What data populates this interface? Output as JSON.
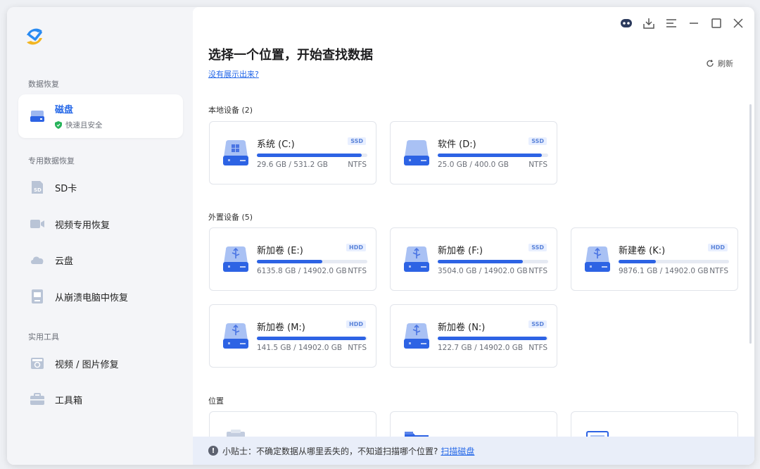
{
  "sidebar": {
    "section_data_recovery": "数据恢复",
    "disk": {
      "label": "磁盘",
      "sub": "快速且安全"
    },
    "section_special": "专用数据恢复",
    "items": [
      {
        "label": "SD卡"
      },
      {
        "label": "视频专用恢复"
      },
      {
        "label": "云盘"
      },
      {
        "label": "从崩溃电脑中恢复"
      }
    ],
    "section_tools": "实用工具",
    "tools": [
      {
        "label": "视频 / 图片修复"
      },
      {
        "label": "工具箱"
      }
    ]
  },
  "main": {
    "title": "选择一个位置，开始查找数据",
    "not_shown_link": "没有展示出来?",
    "refresh": "刷新",
    "local_label": "本地设备 (2)",
    "external_label": "外置设备 (5)",
    "location_label": "位置",
    "local_drives": [
      {
        "name": "系统 (C:)",
        "badge": "SSD",
        "size": "29.6 GB / 531.2 GB",
        "fs": "NTFS",
        "usage": 0.95
      },
      {
        "name": "软件 (D:)",
        "badge": "SSD",
        "size": "25.0 GB / 400.0 GB",
        "fs": "NTFS",
        "usage": 0.94
      }
    ],
    "external_drives": [
      {
        "name": "新加卷 (E:)",
        "badge": "HDD",
        "size": "6135.8 GB / 14902.0 GB",
        "fs": "NTFS",
        "usage": 0.59
      },
      {
        "name": "新加卷 (F:)",
        "badge": "SSD",
        "size": "3504.0 GB / 14902.0 GB",
        "fs": "NTFS",
        "usage": 0.77
      },
      {
        "name": "新建卷 (K:)",
        "badge": "HDD",
        "size": "9876.1 GB / 14902.0 GB",
        "fs": "NTFS",
        "usage": 0.34
      },
      {
        "name": "新加卷 (M:)",
        "badge": "HDD",
        "size": "141.5 GB / 14902.0 GB",
        "fs": "NTFS",
        "usage": 0.99
      },
      {
        "name": "新加卷 (N:)",
        "badge": "SSD",
        "size": "122.7 GB / 14902.0 GB",
        "fs": "NTFS",
        "usage": 0.99
      }
    ],
    "tip": {
      "text": "小贴士：不确定数据从哪里丢失的，不知道扫描哪个位置?",
      "link": "扫描磁盘"
    }
  },
  "window_controls": [
    "assistant-icon",
    "download-icon",
    "menu-icon",
    "minimize-icon",
    "maximize-icon",
    "close-icon"
  ]
}
